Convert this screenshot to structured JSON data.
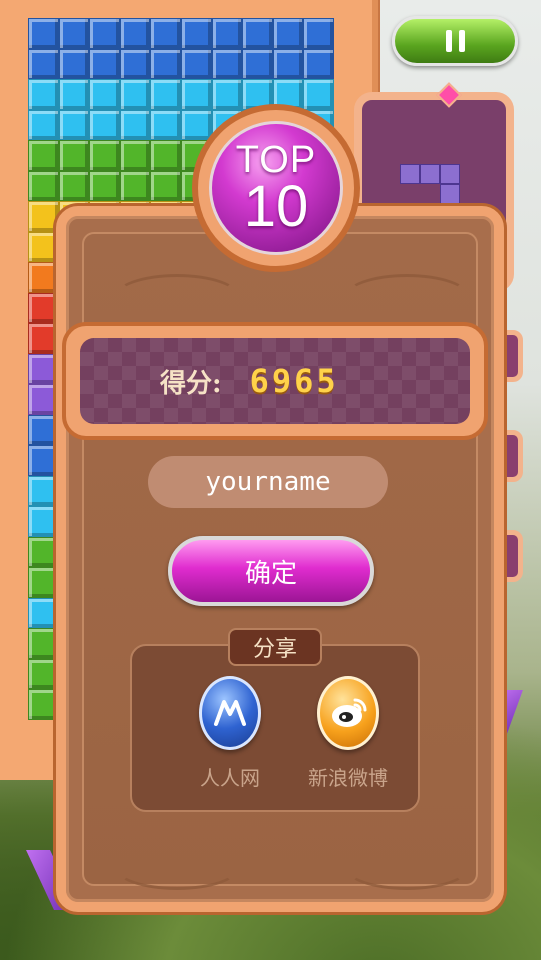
{
  "popup": {
    "badge_top": "TOP",
    "badge_rank": "10",
    "score_label": "得分:",
    "score_value": "6965",
    "name_input_value": "yourname",
    "confirm_label": "确定",
    "share_title": "分享",
    "share_options": [
      {
        "label": "人人网",
        "icon": "renren-icon"
      },
      {
        "label": "新浪微博",
        "icon": "sina-weibo-icon"
      }
    ]
  },
  "hud": {
    "pause_icon": "pause-icon"
  },
  "board": {
    "columns": 10,
    "row_colors": [
      "#2f6fd6",
      "#2f6fd6",
      "#2fc0f0",
      "#2fc0f0",
      "#52b52a",
      "#52b52a",
      "#f3c21c",
      "#f3c21c",
      "#f27a1e",
      "#e23b2a",
      "#e23b2a",
      "#8c5ad8",
      "#8c5ad8",
      "#2f6fd6",
      "#2f6fd6",
      "#2fc0f0",
      "#2fc0f0",
      "#52b52a",
      "#52b52a",
      "#2fc0f0",
      "#52b52a",
      "#52b52a",
      "#52b52a"
    ]
  },
  "colors": {
    "accent_magenta": "#d33ad0",
    "panel_brown": "#a86e4c",
    "frame_orange": "#f0a370",
    "score_gold": "#ffd24a"
  }
}
